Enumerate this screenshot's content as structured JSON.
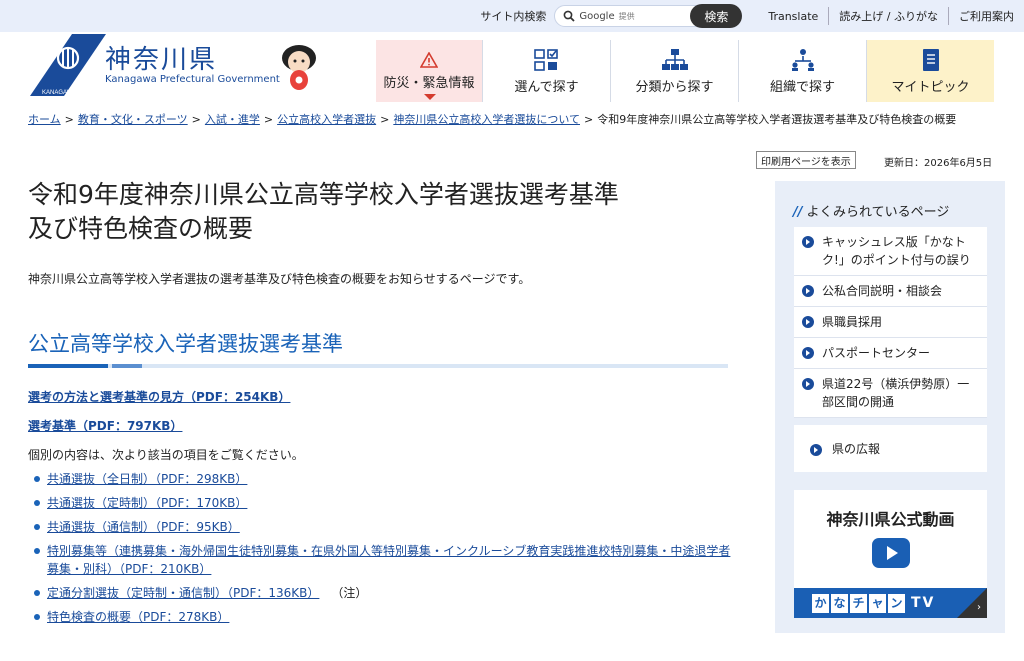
{
  "util": {
    "site_search_label": "サイト内検索",
    "google": "Google",
    "google_sub": "提供",
    "search_button": "検索",
    "translate": "Translate",
    "readaloud": "読み上げ / ふりがな",
    "guide": "ご利用案内"
  },
  "header": {
    "logo_title": "神奈川県",
    "logo_sub": "Kanagawa Prefectural Government",
    "logo_mark_text": "KANAGAWA",
    "nav": [
      "防災・緊急情報",
      "選んで探す",
      "分類から探す",
      "組織で探す",
      "マイトピック"
    ]
  },
  "breadcrumb": {
    "links": [
      "ホーム",
      "教育・文化・スポーツ",
      "入試・進学",
      "公立高校入学者選抜",
      "神奈川県公立高校入学者選抜について"
    ],
    "current": "令和9年度神奈川県公立高等学校入学者選抜選考基準及び特色検査の概要",
    "sep": ">"
  },
  "print_button": "印刷用ページを表示",
  "updated": "更新日：2026年6月5日",
  "title_line1": "令和9年度神奈川県公立高等学校入学者選抜選考基準",
  "title_line2": "及び特色検査の概要",
  "intro": "神奈川県公立高等学校入学者選抜の選考基準及び特色検査の概要をお知らせするページです。",
  "section_title": "公立高等学校入学者選抜選考基準",
  "link_method": "選考の方法と選考基準の見方（PDF：254KB）",
  "link_criteria": "選考基準（PDF：797KB）",
  "detail_text": "個別の内容は、次より該当の項目をご覧ください。",
  "items": [
    {
      "text": "共通選抜（全日制）（PDF：298KB）",
      "note": ""
    },
    {
      "text": "共通選抜（定時制）（PDF：170KB）",
      "note": ""
    },
    {
      "text": "共通選抜（通信制）（PDF：95KB）",
      "note": ""
    },
    {
      "text": "特別募集等（連携募集・海外帰国生徒特別募集・在県外国人等特別募集・インクルーシブ教育実践推進校特別募集・中途退学者募集・別科）（PDF：210KB）",
      "note": ""
    },
    {
      "text": "定通分割選抜（定時制・通信制）（PDF：136KB）",
      "note": "（注）"
    },
    {
      "text": "特色検査の概要（PDF：278KB）",
      "note": ""
    }
  ],
  "sidebar": {
    "heading": "よくみられているページ",
    "items": [
      "キャッシュレス版「かなトク!」のポイント付与の誤り",
      "公私合同説明・相談会",
      "県職員採用",
      "パスポートセンター",
      "県道22号（横浜伊勢原）一部区間の開通"
    ],
    "pr": "県の広報",
    "video_title": "神奈川県公式動画",
    "kana": [
      "か",
      "な",
      "チ",
      "ャ",
      "ン"
    ],
    "tv": "TV"
  },
  "colors": {
    "accent": "#1a63b8",
    "brand": "#1a4b9a",
    "emergency_bg": "#fce4e4",
    "mytopic_bg": "#fdf2c9",
    "sidebar_bg": "#e8eef8"
  }
}
